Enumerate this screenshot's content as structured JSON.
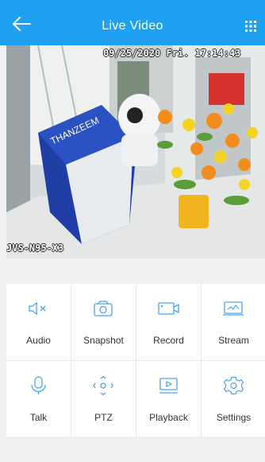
{
  "header": {
    "title": "Live Video",
    "back_icon": "back-arrow-icon",
    "menu_icon": "grid-menu-icon"
  },
  "video": {
    "timestamp": "09/25/2020 Fri. 17:14:43",
    "device_name": "JVS-N95-X3",
    "box_text": "THANZEEM"
  },
  "controls": [
    {
      "label": "Audio",
      "icon": "speaker-muted-icon"
    },
    {
      "label": "Snapshot",
      "icon": "camera-icon"
    },
    {
      "label": "Record",
      "icon": "video-record-icon"
    },
    {
      "label": "Stream",
      "icon": "stream-monitor-icon"
    },
    {
      "label": "Talk",
      "icon": "microphone-icon"
    },
    {
      "label": "PTZ",
      "icon": "ptz-arrows-icon"
    },
    {
      "label": "Playback",
      "icon": "playback-icon"
    },
    {
      "label": "Settings",
      "icon": "gear-icon"
    }
  ],
  "colors": {
    "header": "#1ea1f1",
    "icon": "#4aa3ef"
  }
}
